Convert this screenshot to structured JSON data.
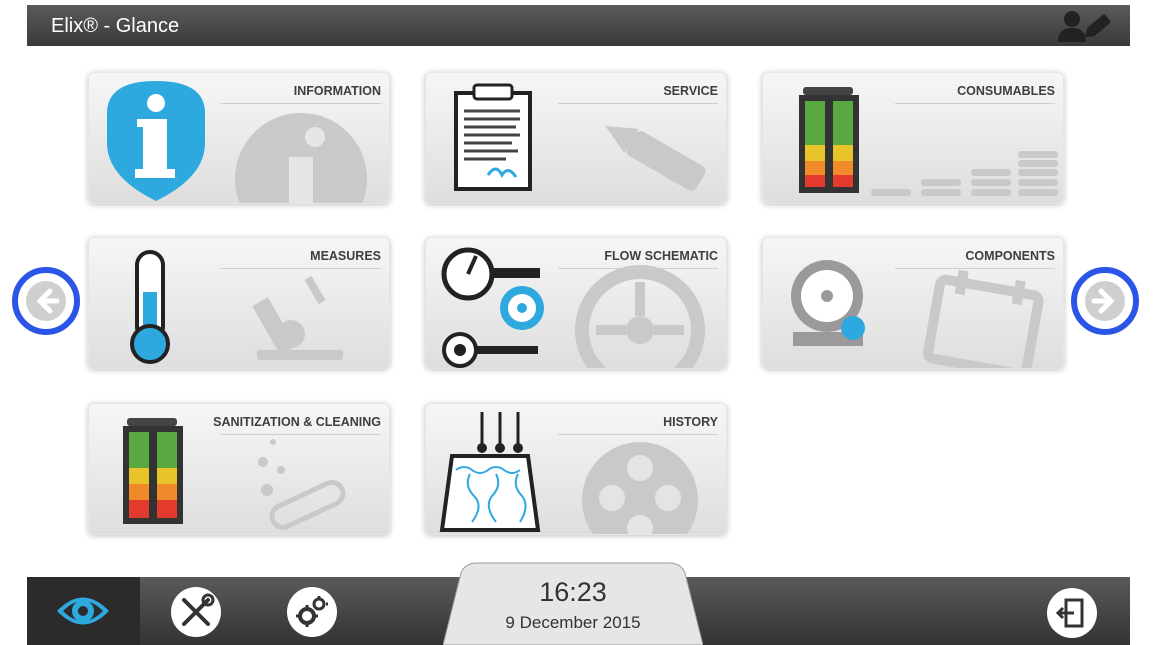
{
  "header": {
    "title": "Elix® - Glance",
    "user_icon": "user-edit-icon"
  },
  "tiles": [
    {
      "label": "INFORMATION",
      "icon": "information-icon"
    },
    {
      "label": "SERVICE",
      "icon": "clipboard-icon"
    },
    {
      "label": "CONSUMABLES",
      "icon": "cartridge-icon"
    },
    {
      "label": "MEASURES",
      "icon": "thermometer-icon"
    },
    {
      "label": "FLOW SCHEMATIC",
      "icon": "flow-gauge-icon"
    },
    {
      "label": "COMPONENTS",
      "icon": "pump-icon"
    },
    {
      "label": "SANITIZATION & CLEANING",
      "icon": "cartridge-icon"
    },
    {
      "label": "HISTORY",
      "icon": "history-icon"
    }
  ],
  "nav": {
    "prev_icon": "arrow-left-icon",
    "next_icon": "arrow-right-icon"
  },
  "footer": {
    "time": "16:23",
    "date": "9 December 2015",
    "tabs": [
      "eye-icon",
      "tools-icon",
      "gears-icon"
    ],
    "logout_icon": "logout-icon"
  },
  "colors": {
    "accent_blue": "#2ea9e0",
    "ring_blue": "#2b55e6",
    "bar_dark": "#3a3a3a"
  }
}
